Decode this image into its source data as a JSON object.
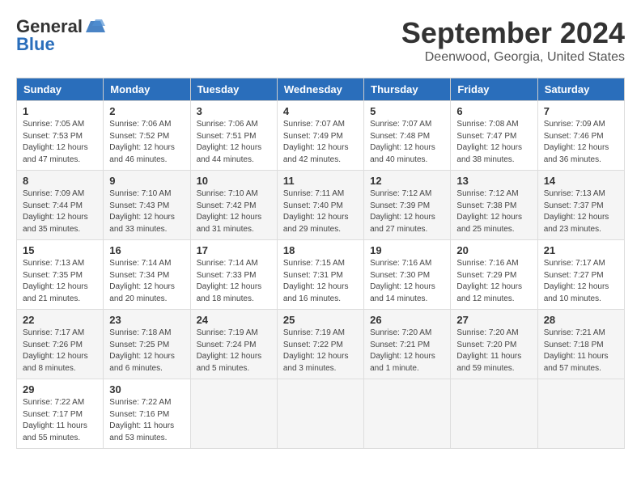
{
  "logo": {
    "line1": "General",
    "line2": "Blue"
  },
  "title": "September 2024",
  "location": "Deenwood, Georgia, United States",
  "headers": [
    "Sunday",
    "Monday",
    "Tuesday",
    "Wednesday",
    "Thursday",
    "Friday",
    "Saturday"
  ],
  "weeks": [
    [
      {
        "day": "1",
        "rise": "7:05 AM",
        "set": "7:53 PM",
        "daylight": "12 hours and 47 minutes."
      },
      {
        "day": "2",
        "rise": "7:06 AM",
        "set": "7:52 PM",
        "daylight": "12 hours and 46 minutes."
      },
      {
        "day": "3",
        "rise": "7:06 AM",
        "set": "7:51 PM",
        "daylight": "12 hours and 44 minutes."
      },
      {
        "day": "4",
        "rise": "7:07 AM",
        "set": "7:49 PM",
        "daylight": "12 hours and 42 minutes."
      },
      {
        "day": "5",
        "rise": "7:07 AM",
        "set": "7:48 PM",
        "daylight": "12 hours and 40 minutes."
      },
      {
        "day": "6",
        "rise": "7:08 AM",
        "set": "7:47 PM",
        "daylight": "12 hours and 38 minutes."
      },
      {
        "day": "7",
        "rise": "7:09 AM",
        "set": "7:46 PM",
        "daylight": "12 hours and 36 minutes."
      }
    ],
    [
      {
        "day": "8",
        "rise": "7:09 AM",
        "set": "7:44 PM",
        "daylight": "12 hours and 35 minutes."
      },
      {
        "day": "9",
        "rise": "7:10 AM",
        "set": "7:43 PM",
        "daylight": "12 hours and 33 minutes."
      },
      {
        "day": "10",
        "rise": "7:10 AM",
        "set": "7:42 PM",
        "daylight": "12 hours and 31 minutes."
      },
      {
        "day": "11",
        "rise": "7:11 AM",
        "set": "7:40 PM",
        "daylight": "12 hours and 29 minutes."
      },
      {
        "day": "12",
        "rise": "7:12 AM",
        "set": "7:39 PM",
        "daylight": "12 hours and 27 minutes."
      },
      {
        "day": "13",
        "rise": "7:12 AM",
        "set": "7:38 PM",
        "daylight": "12 hours and 25 minutes."
      },
      {
        "day": "14",
        "rise": "7:13 AM",
        "set": "7:37 PM",
        "daylight": "12 hours and 23 minutes."
      }
    ],
    [
      {
        "day": "15",
        "rise": "7:13 AM",
        "set": "7:35 PM",
        "daylight": "12 hours and 21 minutes."
      },
      {
        "day": "16",
        "rise": "7:14 AM",
        "set": "7:34 PM",
        "daylight": "12 hours and 20 minutes."
      },
      {
        "day": "17",
        "rise": "7:14 AM",
        "set": "7:33 PM",
        "daylight": "12 hours and 18 minutes."
      },
      {
        "day": "18",
        "rise": "7:15 AM",
        "set": "7:31 PM",
        "daylight": "12 hours and 16 minutes."
      },
      {
        "day": "19",
        "rise": "7:16 AM",
        "set": "7:30 PM",
        "daylight": "12 hours and 14 minutes."
      },
      {
        "day": "20",
        "rise": "7:16 AM",
        "set": "7:29 PM",
        "daylight": "12 hours and 12 minutes."
      },
      {
        "day": "21",
        "rise": "7:17 AM",
        "set": "7:27 PM",
        "daylight": "12 hours and 10 minutes."
      }
    ],
    [
      {
        "day": "22",
        "rise": "7:17 AM",
        "set": "7:26 PM",
        "daylight": "12 hours and 8 minutes."
      },
      {
        "day": "23",
        "rise": "7:18 AM",
        "set": "7:25 PM",
        "daylight": "12 hours and 6 minutes."
      },
      {
        "day": "24",
        "rise": "7:19 AM",
        "set": "7:24 PM",
        "daylight": "12 hours and 5 minutes."
      },
      {
        "day": "25",
        "rise": "7:19 AM",
        "set": "7:22 PM",
        "daylight": "12 hours and 3 minutes."
      },
      {
        "day": "26",
        "rise": "7:20 AM",
        "set": "7:21 PM",
        "daylight": "12 hours and 1 minute."
      },
      {
        "day": "27",
        "rise": "7:20 AM",
        "set": "7:20 PM",
        "daylight": "11 hours and 59 minutes."
      },
      {
        "day": "28",
        "rise": "7:21 AM",
        "set": "7:18 PM",
        "daylight": "11 hours and 57 minutes."
      }
    ],
    [
      {
        "day": "29",
        "rise": "7:22 AM",
        "set": "7:17 PM",
        "daylight": "11 hours and 55 minutes."
      },
      {
        "day": "30",
        "rise": "7:22 AM",
        "set": "7:16 PM",
        "daylight": "11 hours and 53 minutes."
      },
      null,
      null,
      null,
      null,
      null
    ]
  ]
}
